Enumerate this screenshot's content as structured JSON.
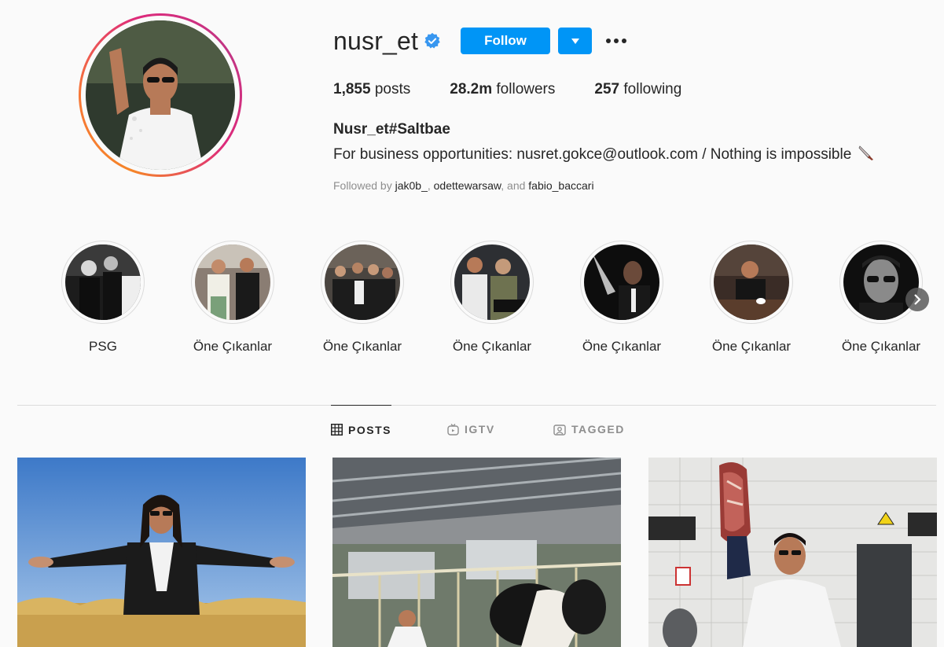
{
  "profile": {
    "username": "nusr_et",
    "follow_label": "Follow",
    "stats": {
      "posts_count": "1,855",
      "posts_label": "posts",
      "followers_count": "28.2m",
      "followers_label": "followers",
      "following_count": "257",
      "following_label": "following"
    },
    "full_name": "Nusr_et#Saltbae",
    "bio": "For business opportunities: nusret.gokce@outlook.com / Nothing is impossible",
    "followed_by": {
      "prefix": "Followed by",
      "users": [
        "jak0b_",
        "odettewarsaw",
        "fabio_baccari"
      ],
      "separator": ",",
      "and": ", and"
    }
  },
  "highlights": [
    {
      "label": "PSG"
    },
    {
      "label": "Öne Çıkanlar"
    },
    {
      "label": "Öne Çıkanlar"
    },
    {
      "label": "Öne Çıkanlar"
    },
    {
      "label": "Öne Çıkanlar"
    },
    {
      "label": "Öne Çıkanlar"
    },
    {
      "label": "Öne Çıkanlar"
    }
  ],
  "tabs": [
    {
      "label": "POSTS",
      "icon": "grid-icon",
      "active": true
    },
    {
      "label": "IGTV",
      "icon": "igtv-icon",
      "active": false
    },
    {
      "label": "TAGGED",
      "icon": "tagged-icon",
      "active": false
    }
  ],
  "colors": {
    "accent": "#0095f6",
    "verified": "#3897f0",
    "text": "#262626",
    "muted": "#8e8e8e",
    "border": "#dbdbdb"
  }
}
